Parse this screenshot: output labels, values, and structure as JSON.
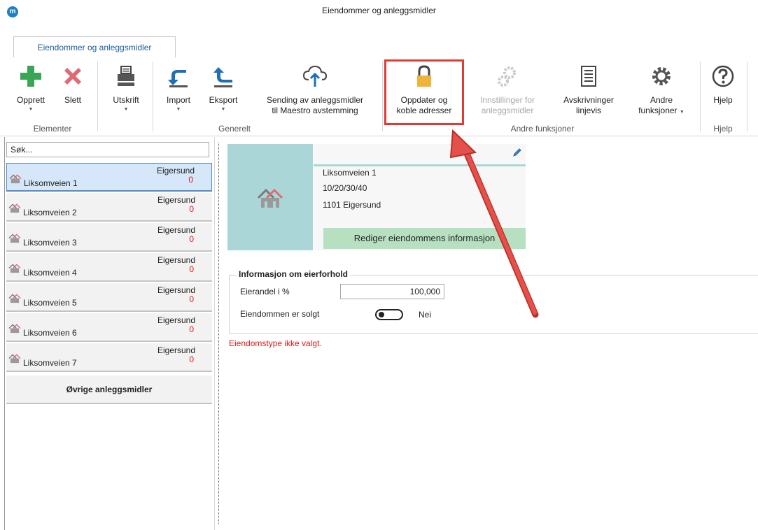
{
  "window": {
    "title": "Eiendommer og anleggsmidler",
    "logo_letter": "m"
  },
  "tabs": [
    {
      "label": "Eiendommer og anleggsmidler",
      "active": true
    }
  ],
  "ribbon": {
    "buttons": {
      "opprett": {
        "label": "Opprett",
        "icon": "plus-icon"
      },
      "slett": {
        "label": "Slett",
        "icon": "delete-x-icon"
      },
      "utskrift": {
        "label": "Utskrift",
        "icon": "printer-icon"
      },
      "import": {
        "label": "Import",
        "icon": "import-arrow-icon"
      },
      "eksport": {
        "label": "Eksport",
        "icon": "export-arrow-icon"
      },
      "sending_line1": "Sending av anleggsmidler",
      "sending_line2": "til  Maestro avstemming",
      "oppdater_line1": "Oppdater og",
      "oppdater_line2": "koble adresser",
      "innstillinger_line1": "Innstillinger for",
      "innstillinger_line2": "anleggsmidler",
      "avskrivninger_line1": "Avskrivninger",
      "avskrivninger_line2": "linjevis",
      "andre_line1": "Andre",
      "andre_line2": "funksjoner",
      "hjelp": "Hjelp"
    },
    "groups": {
      "elementer": "Elementer",
      "generelt": "Generelt",
      "andre": "Andre funksjoner",
      "hjelp": "Hjelp"
    },
    "caret": "▼"
  },
  "search": {
    "value": "Søk..."
  },
  "properties": [
    {
      "name": "Liksomveien 1",
      "city": "Eigersund",
      "count": "0",
      "selected": true
    },
    {
      "name": "Liksomveien 2",
      "city": "Eigersund",
      "count": "0"
    },
    {
      "name": "Liksomveien 3",
      "city": "Eigersund",
      "count": "0"
    },
    {
      "name": "Liksomveien 4",
      "city": "Eigersund",
      "count": "0"
    },
    {
      "name": "Liksomveien 5",
      "city": "Eigersund",
      "count": "0"
    },
    {
      "name": "Liksomveien 6",
      "city": "Eigersund",
      "count": "0"
    },
    {
      "name": "Liksomveien 7",
      "city": "Eigersund",
      "count": "0"
    }
  ],
  "other_assets": "Øvrige anleggsmidler",
  "detail": {
    "address_line1": "Liksomveien 1",
    "address_line2": "10/20/30/40",
    "address_line3": "1101 Eigersund",
    "edit_button": "Rediger eiendommens informasjon",
    "ownership": {
      "legend": "Informasjon om eierforhold",
      "share_label": "Eierandel i %",
      "share_value": "100,000",
      "sold_label": "Eiendommen er solgt",
      "sold_value": "Nei"
    },
    "error": "Eiendomstype ikke valgt."
  },
  "colors": {
    "highlight": "#e03b34",
    "accent_green": "#3aa655",
    "error": "#e01818",
    "selected": "#d5e7f8"
  }
}
